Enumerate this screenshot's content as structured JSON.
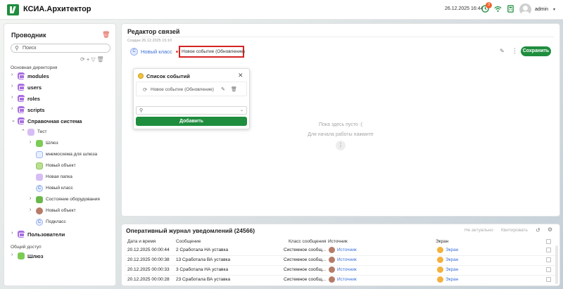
{
  "app": {
    "title": "КСИА.Архитектор",
    "datetime": "26.12.2025 16:44",
    "notification_count": "3",
    "user": "admin"
  },
  "explorer": {
    "title": "Проводник",
    "search_placeholder": "Поиск",
    "main_dir_label": "Основная директория",
    "shared_label": "Общий доступ",
    "items": [
      {
        "label": "modules"
      },
      {
        "label": "users"
      },
      {
        "label": "roles"
      },
      {
        "label": "scripts"
      },
      {
        "label": "Справочная система"
      },
      {
        "label": "Тест"
      },
      {
        "label": "Шлюз"
      },
      {
        "label": "мнемосхема для шлюза"
      },
      {
        "label": "Новый объект"
      },
      {
        "label": "Новая папка"
      },
      {
        "label": "Новый класс"
      },
      {
        "label": "Состояние оборудования"
      },
      {
        "label": "Новый объект"
      },
      {
        "label": "Подкласс"
      },
      {
        "label": "Пользователи"
      },
      {
        "label": "Шлюз"
      }
    ]
  },
  "editor": {
    "title": "Редактор связей",
    "created": "Создан 26.12.2025 15:10",
    "breadcrumb_class": "Новый класс",
    "breadcrumb_active": "Новое событие (Обновление)",
    "save_label": "Сохранить",
    "empty_title": "Пока здесь пусто :(",
    "empty_hint": "Для начала работы нажмите"
  },
  "events_popup": {
    "title": "Список событий",
    "event": "Новое событие (Обновление)",
    "add_label": "Добавить"
  },
  "journal": {
    "title": "Оперативный журнал уведомлений (24566)",
    "not_actual": "Не актуально",
    "quit": "Квитировать",
    "columns": [
      "Дата и время",
      "Сообщение",
      "Класс сообщения",
      "Источник",
      "Экран"
    ],
    "rows": [
      {
        "time": "20.12.2025 00:00:44",
        "msg": "2 Сработала НА уставка",
        "cls": "Системное сообщ...",
        "src": "Источник",
        "screen": "Экран"
      },
      {
        "time": "20.12.2025 00:00:38",
        "msg": "13 Сработала ВА уставка",
        "cls": "Системное сообщ...",
        "src": "Источник",
        "screen": "Экран"
      },
      {
        "time": "20.12.2025 00:00:33",
        "msg": "3 Сработала НА уставка",
        "cls": "Системное сообщ...",
        "src": "Источник",
        "screen": "Экран"
      },
      {
        "time": "20.12.2025 00:00:28",
        "msg": "23 Сработала ВА уставка",
        "cls": "Системное сообщ...",
        "src": "Источник",
        "screen": "Экран"
      }
    ]
  }
}
